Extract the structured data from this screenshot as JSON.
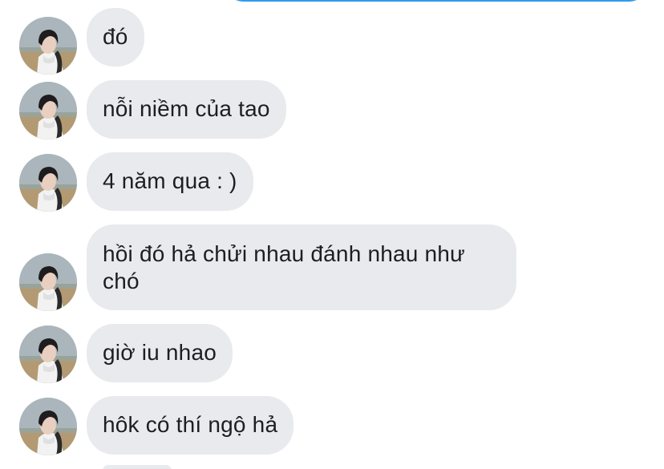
{
  "messages": [
    {
      "text": "đó"
    },
    {
      "text": "nỗi niềm của tao"
    },
    {
      "text": "4 năm qua : )"
    },
    {
      "text": "hồi đó hả chửi nhau đánh nhau như chó"
    },
    {
      "text": "giờ iu nhao"
    },
    {
      "text": "hôk có thí ngộ hả"
    }
  ],
  "colors": {
    "incoming_bubble": "#e9eaee",
    "outgoing_bubble_border": "#2e9bf0",
    "text": "#1c1e21"
  }
}
